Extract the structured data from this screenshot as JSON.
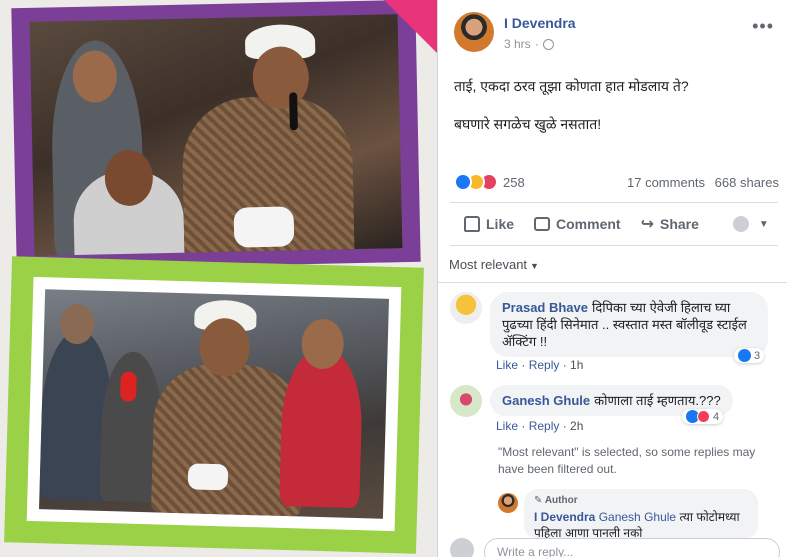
{
  "post": {
    "author": "I Devendra",
    "time": "3 hrs",
    "text_line1": "ताई, एकदा ठरव तूझा कोणता हात मोडलाय ते?",
    "text_line2": "बघणारे सगळेच खुळे नसतात!",
    "reaction_count": "258",
    "comments_count": "17 comments",
    "shares_count": "668 shares"
  },
  "actions": {
    "like": "Like",
    "comment": "Comment",
    "share": "Share"
  },
  "sort": {
    "label": "Most relevant"
  },
  "comments": [
    {
      "name": "Prasad Bhave",
      "text": "दिपिका च्या ऐवेजी हिलाच घ्या पुढच्या हिंदी सिनेमात .. स्वस्तात मस्त बॉलीवूड स्टाईल ॲक्टिंग !!",
      "like": "Like",
      "reply": "Reply",
      "time": "1h",
      "reactions": "3"
    },
    {
      "name": "Ganesh Ghule",
      "text": "कोणाला ताई म्हणताय.???",
      "like": "Like",
      "reply": "Reply",
      "time": "2h",
      "reactions": "4"
    }
  ],
  "filter_note": "\"Most relevant\" is selected, so some replies may have been filtered out.",
  "reply": {
    "badge": "Author",
    "name": "I Devendra",
    "mention": "Ganesh Ghule",
    "text": "त्या फोटोमध्या पहिला आणा पानली नको"
  },
  "composer": {
    "placeholder": "Write a reply..."
  },
  "icons": {
    "globe": "globe-icon",
    "more": "more-icon",
    "like": "thumbs-up-icon",
    "comment": "comment-icon",
    "share": "share-icon"
  }
}
